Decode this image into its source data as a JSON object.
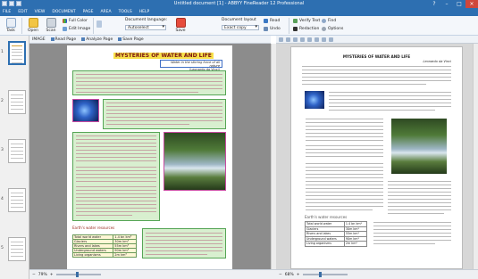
{
  "window": {
    "title": "Untitled document [1] - ABBYY FineReader 12 Professional"
  },
  "menu": [
    "FILE",
    "EDIT",
    "VIEW",
    "DOCUMENT",
    "PAGE",
    "AREA",
    "TOOLS",
    "HELP"
  ],
  "ribbon": {
    "task": "Task",
    "open": "Open",
    "scan": "Scan",
    "full_color": "Full Color",
    "edit_image": "Edit Image",
    "document_language_label": "Document language:",
    "document_language_value": "Autoselect",
    "save": "Save",
    "document_layout_label": "Document layout",
    "document_layout_value": "Exact copy",
    "read": "Read",
    "verify_text": "Verify Text",
    "find": "Find",
    "undo": "Undo",
    "redaction": "Redaction",
    "options": "Options"
  },
  "thumbnails": {
    "pages": [
      "1",
      "2",
      "3",
      "4",
      "5"
    ]
  },
  "image_pane": {
    "label": "IMAGE",
    "read_page": "Read Page",
    "analyze_page": "Analyze Page",
    "save_page": "Save Page",
    "zoom": "79%"
  },
  "text_pane": {
    "zoom": "68%"
  },
  "document": {
    "title": "MYSTERIES OF WATER AND LIFE",
    "subtitle_line1": "Water in the stirring force of all nature",
    "subtitle_line2": "(Leonardo da Vinci)",
    "caption": "Earth's water resources",
    "table": [
      [
        "Total world water",
        "1.4 bn km³"
      ],
      [
        "Glaciers",
        "30m km³"
      ],
      [
        "Rivers and lakes",
        "55m km³"
      ],
      [
        "Underground waters",
        "90m km³"
      ],
      [
        "Living organisms",
        "2m km³"
      ]
    ]
  },
  "text_document": {
    "title": "MYSTERIES OF WATER AND LIFE",
    "subtitle": "Leonardo da Vinci"
  }
}
